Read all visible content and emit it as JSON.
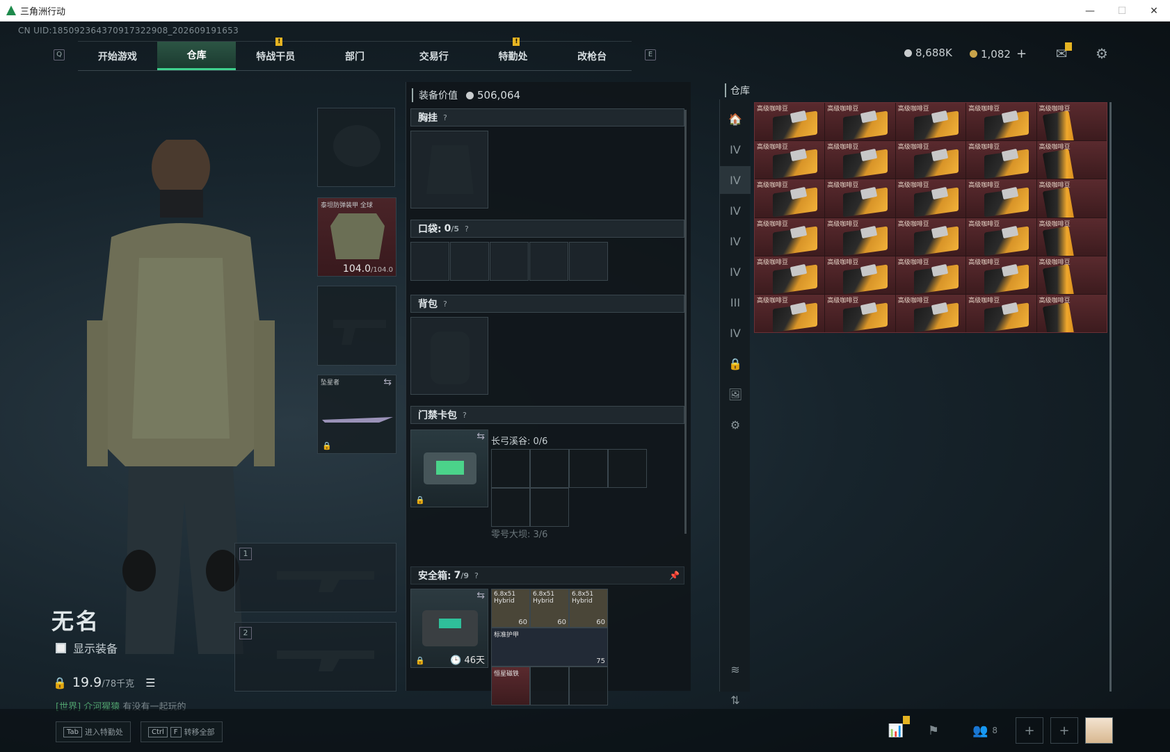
{
  "window": {
    "title": "三角洲行动",
    "controls": [
      "—",
      "☐",
      "✕"
    ]
  },
  "uid": "CN UID:185092364370917322908_202609191653",
  "nav": {
    "left_key": "Q",
    "right_key": "E",
    "tabs": [
      {
        "label": "开始游戏",
        "active": false,
        "flag": false
      },
      {
        "label": "仓库",
        "active": true,
        "flag": false
      },
      {
        "label": "特战干员",
        "active": false,
        "flag": true
      },
      {
        "label": "部门",
        "active": false,
        "flag": false
      },
      {
        "label": "交易行",
        "active": false,
        "flag": false
      },
      {
        "label": "特勤处",
        "active": false,
        "flag": true
      },
      {
        "label": "改枪台",
        "active": false,
        "flag": false
      }
    ]
  },
  "currency": {
    "silver": "8,688K",
    "gold": "1,082",
    "add": "+"
  },
  "character": {
    "name": "无名",
    "show_equipment": "显示装备",
    "weight_current": "19.9",
    "weight_max": "/78千克"
  },
  "chat": {
    "channel": "[世界]",
    "user": "介河猩猿",
    "message": "有没有一起玩的"
  },
  "loadout": {
    "armor": {
      "label": "泰坦防弹装甲 全球",
      "durability": "104.0",
      "durability_max": "/104.0"
    },
    "melee": {
      "label": "坠星者"
    },
    "weapon_slots": [
      "1",
      "2"
    ]
  },
  "equipment": {
    "value_label": "装备价值",
    "value": "506,064",
    "chest": "胸挂",
    "pockets": "口袋:",
    "pockets_count": "0",
    "pockets_max": "/5",
    "backpack": "背包",
    "keycard": "门禁卡包",
    "keycard_map1": "长弓溪谷: 0/6",
    "keycard_map2": "零号大坝: 3/6",
    "safebox": "安全箱:",
    "safebox_count": "7",
    "safebox_max": "/9",
    "safebox_time": "46天",
    "safebox_items": [
      {
        "label": "6.8x51 Hybrid",
        "count": "60"
      },
      {
        "label": "6.8x51 Hybrid",
        "count": "60"
      },
      {
        "label": "6.8x51 Hybrid",
        "count": "60"
      },
      {
        "label": "标准护甲",
        "count": "75"
      },
      {
        "label": "恒星磁铁"
      }
    ]
  },
  "warehouse": {
    "title": "仓库",
    "item_label": "高级咖啡豆",
    "grid": [
      [
        "box",
        "box",
        "box",
        "box",
        "bag"
      ],
      [
        "box",
        "box",
        "box",
        "box",
        "bag"
      ],
      [
        "box",
        "box",
        "box",
        "box",
        "bag"
      ],
      [
        "box",
        "box",
        "box",
        "box",
        "bag"
      ],
      [
        "box",
        "box",
        "box",
        "box",
        "bag"
      ],
      [
        "box",
        "box",
        "box",
        "box",
        "bag"
      ]
    ]
  },
  "bottom": {
    "hint1_key": "Tab",
    "hint1": "进入特勤处",
    "hint2_key1": "Ctrl",
    "hint2_key2": "F",
    "hint2": "转移全部",
    "friends": "8"
  },
  "colors": {
    "accent": "#3fd08e",
    "rarity_red": "#5a2a2e",
    "flag": "#e6b422"
  }
}
